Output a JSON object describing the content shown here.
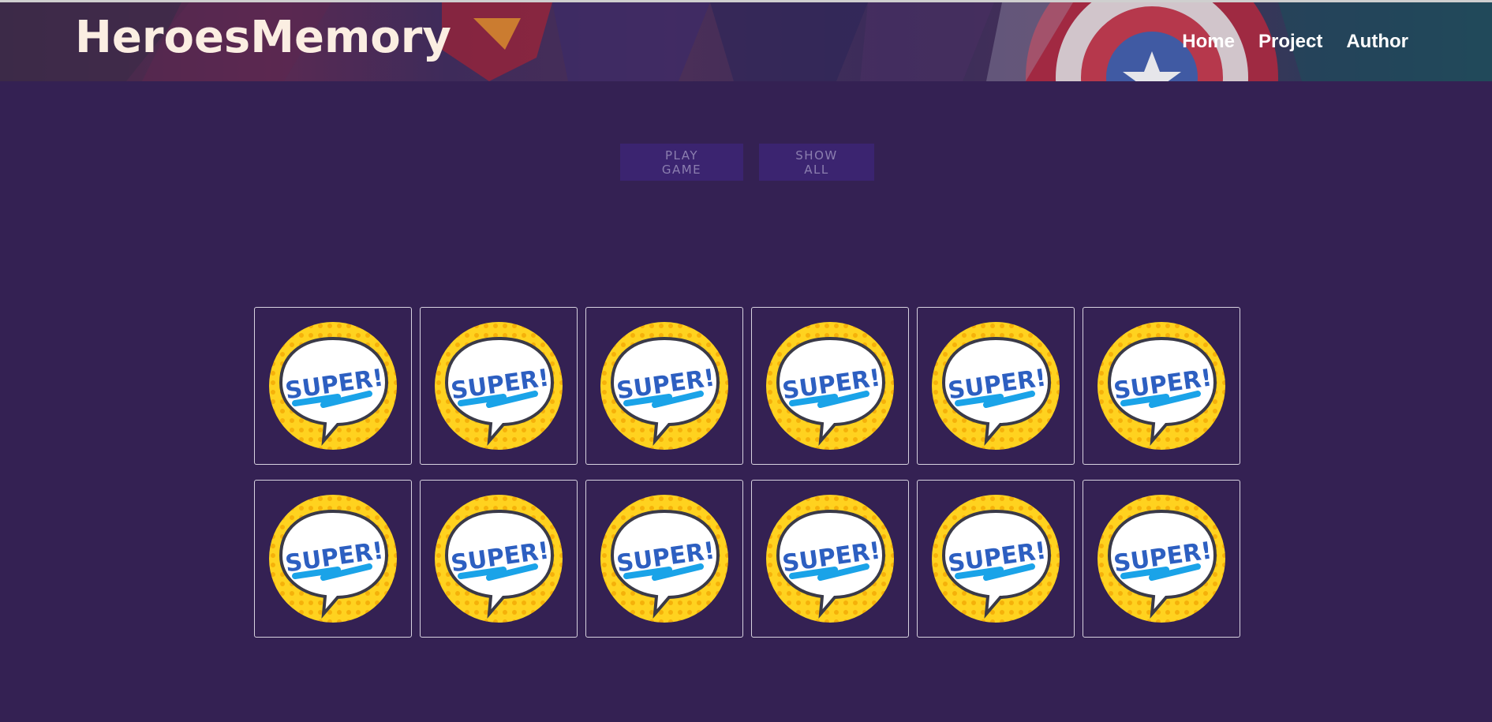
{
  "header": {
    "brand": "HeroesMemory",
    "nav": [
      {
        "label": "Home"
      },
      {
        "label": "Project"
      },
      {
        "label": "Author"
      }
    ]
  },
  "controls": {
    "play_label": "PLAY GAME",
    "show_label": "SHOW ALL"
  },
  "cards": [
    {
      "face": "SUPER!"
    },
    {
      "face": "SUPER!"
    },
    {
      "face": "SUPER!"
    },
    {
      "face": "SUPER!"
    },
    {
      "face": "SUPER!"
    },
    {
      "face": "SUPER!"
    },
    {
      "face": "SUPER!"
    },
    {
      "face": "SUPER!"
    },
    {
      "face": "SUPER!"
    },
    {
      "face": "SUPER!"
    },
    {
      "face": "SUPER!"
    },
    {
      "face": "SUPER!"
    }
  ],
  "colors": {
    "background": "#342153",
    "button_bg": "#3b2470",
    "button_text": "#8b7eaf",
    "badge_yellow": "#ffd21f",
    "badge_blue": "#2d5fc1",
    "badge_accent": "#1aa3e8"
  }
}
